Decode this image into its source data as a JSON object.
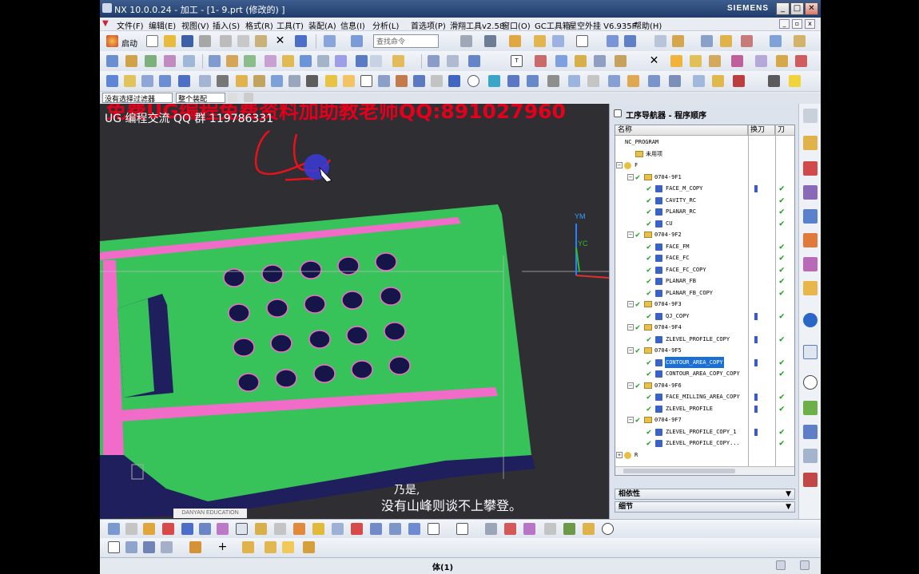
{
  "window": {
    "title": "NX 10.0.0.24 - 加工 - [1- 9.prt  (修改的) ]",
    "brand": "SIEMENS",
    "buttons": [
      "_",
      "□",
      "✕"
    ]
  },
  "menu": {
    "items": [
      "文件(F)",
      "编辑(E)",
      "视图(V)",
      "插入(S)",
      "格式(R)",
      "工具(T)",
      "装配(A)",
      "信息(I)",
      "分析(L)",
      "首选项(P)",
      "滑翔工具v2.58",
      "窗口(O)",
      "GC工具箱",
      "星空外挂 V6.935F",
      "帮助(H)"
    ]
  },
  "toolbar1": {
    "start_label": "启动",
    "search_placeholder": "查找命令"
  },
  "filterbar": {
    "filter": "没有选择过滤器",
    "scope": "整个装配"
  },
  "viewport": {
    "watermark": "免费UG编程免费资料加助教老师QQ:891027960",
    "qq_group": "UG 编程交流 QQ 群 119786331",
    "subtitle_top": "乃是,",
    "subtitle": "没有山峰则谈不上攀登。",
    "edu_label": "DANYAN EDUCATION",
    "axis_ym": "YM",
    "axis_yc": "YC"
  },
  "navigator": {
    "title": "工序导航器 - 程序顺序",
    "col_name": "名称",
    "col_tool": "换刀",
    "col_path": "刀",
    "rows": [
      {
        "label": "NC_PROGRAM",
        "level": 0,
        "type": "root",
        "exp": "",
        "check": false,
        "tool": false,
        "ok": false
      },
      {
        "label": "未用项",
        "level": 1,
        "type": "folder",
        "exp": "",
        "check": false,
        "tool": false,
        "ok": false
      },
      {
        "label": "F",
        "level": 0,
        "type": "key",
        "exp": "-",
        "check": false,
        "tool": false,
        "ok": false
      },
      {
        "label": "0704-9F1",
        "level": 1,
        "type": "group",
        "exp": "-",
        "check": true,
        "tool": false,
        "ok": false
      },
      {
        "label": "FACE_M_COPY",
        "level": 2,
        "type": "op",
        "exp": "",
        "check": true,
        "tool": true,
        "ok": true
      },
      {
        "label": "CAVITY_RC",
        "level": 2,
        "type": "op",
        "exp": "",
        "check": true,
        "tool": false,
        "ok": true
      },
      {
        "label": "PLANAR_RC",
        "level": 2,
        "type": "op",
        "exp": "",
        "check": true,
        "tool": false,
        "ok": true
      },
      {
        "label": "CU",
        "level": 2,
        "type": "op",
        "exp": "",
        "check": true,
        "tool": false,
        "ok": true
      },
      {
        "label": "0704-9F2",
        "level": 1,
        "type": "group",
        "exp": "-",
        "check": true,
        "tool": false,
        "ok": false
      },
      {
        "label": "FACE_FM",
        "level": 2,
        "type": "op",
        "exp": "",
        "check": true,
        "tool": false,
        "ok": true
      },
      {
        "label": "FACE_FC",
        "level": 2,
        "type": "op",
        "exp": "",
        "check": true,
        "tool": false,
        "ok": true
      },
      {
        "label": "FACE_FC_COPY",
        "level": 2,
        "type": "op",
        "exp": "",
        "check": true,
        "tool": false,
        "ok": true
      },
      {
        "label": "PLANAR_FB",
        "level": 2,
        "type": "op",
        "exp": "",
        "check": true,
        "tool": false,
        "ok": true
      },
      {
        "label": "PLANAR_FB_COPY",
        "level": 2,
        "type": "op",
        "exp": "",
        "check": true,
        "tool": false,
        "ok": true
      },
      {
        "label": "0704-9F3",
        "level": 1,
        "type": "group",
        "exp": "-",
        "check": true,
        "tool": false,
        "ok": false
      },
      {
        "label": "QJ_COPY",
        "level": 2,
        "type": "op",
        "exp": "",
        "check": true,
        "tool": true,
        "ok": true
      },
      {
        "label": "0704-9F4",
        "level": 1,
        "type": "group",
        "exp": "-",
        "check": true,
        "tool": false,
        "ok": false
      },
      {
        "label": "ZLEVEL_PROFILE_COPY",
        "level": 2,
        "type": "op",
        "exp": "",
        "check": true,
        "tool": true,
        "ok": true
      },
      {
        "label": "0704-9F5",
        "level": 1,
        "type": "group",
        "exp": "-",
        "check": true,
        "tool": false,
        "ok": false
      },
      {
        "label": "CONTOUR_AREA_COPY",
        "level": 2,
        "type": "op",
        "exp": "",
        "check": true,
        "tool": true,
        "ok": true,
        "selected": true
      },
      {
        "label": "CONTOUR_AREA_COPY_COPY",
        "level": 2,
        "type": "op",
        "exp": "",
        "check": true,
        "tool": false,
        "ok": true
      },
      {
        "label": "0704-9F6",
        "level": 1,
        "type": "group",
        "exp": "-",
        "check": true,
        "tool": false,
        "ok": false
      },
      {
        "label": "FACE_MILLING_AREA_COPY",
        "level": 2,
        "type": "op",
        "exp": "",
        "check": true,
        "tool": true,
        "ok": true
      },
      {
        "label": "ZLEVEL_PROFILE",
        "level": 2,
        "type": "op",
        "exp": "",
        "check": true,
        "tool": true,
        "ok": true
      },
      {
        "label": "0704-9F7",
        "level": 1,
        "type": "group",
        "exp": "-",
        "check": true,
        "tool": false,
        "ok": false
      },
      {
        "label": "ZLEVEL_PROFILE_COPY_1",
        "level": 2,
        "type": "op",
        "exp": "",
        "check": true,
        "tool": true,
        "ok": true
      },
      {
        "label": "ZLEVEL_PROFILE_COPY...",
        "level": 2,
        "type": "op",
        "exp": "",
        "check": true,
        "tool": false,
        "ok": true
      },
      {
        "label": "R",
        "level": 0,
        "type": "key",
        "exp": "+",
        "check": false,
        "tool": false,
        "ok": false
      }
    ],
    "panel_dependencies": "相依性",
    "panel_details": "细节"
  },
  "status": {
    "text": "体(1)"
  },
  "colors": {
    "part_green": "#38c35a",
    "part_pink": "#f06cc8",
    "part_dark": "#1f1f5e",
    "selection_blue": "#1a6fd6"
  }
}
